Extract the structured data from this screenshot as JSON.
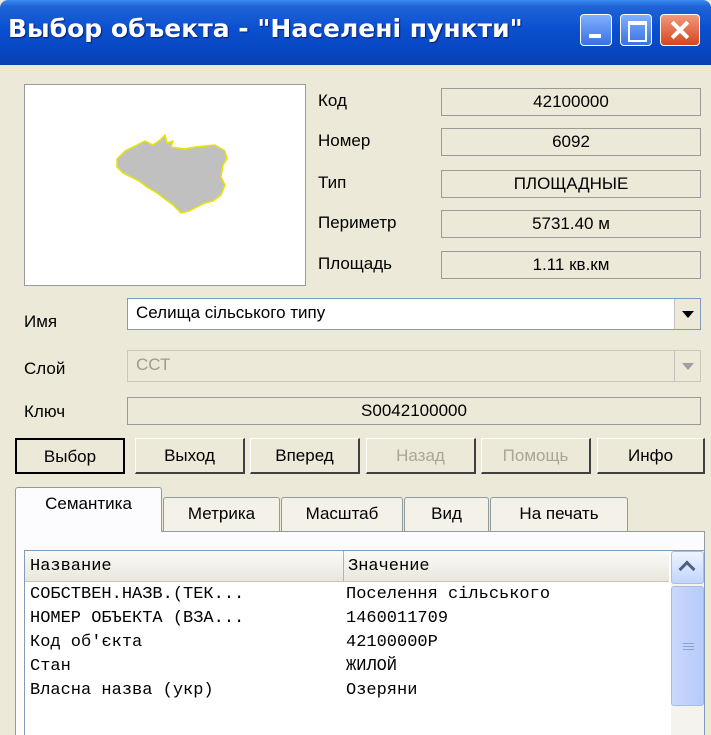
{
  "window": {
    "title": "Выбор объекта - \"Населені пункти\"",
    "buttons": [
      "minimize",
      "maximize",
      "close"
    ]
  },
  "colors": {
    "titlebar": "#0a4fd0",
    "shape_fill": "#c0c0c0",
    "shape_outline": "#e6e600",
    "close": "#d6461e"
  },
  "info": {
    "code_label": "Код",
    "code_value": "42100000",
    "number_label": "Номер",
    "number_value": "6092",
    "type_label": "Тип",
    "type_value": "ПЛОЩАДНЫЕ",
    "perimeter_label": "Периметр",
    "perimeter_value": "5731.40  м",
    "area_label": "Площадь",
    "area_value": "1.11  кв.км"
  },
  "name_row": {
    "label": "Имя",
    "value": "Селища сільського типу"
  },
  "layer_row": {
    "label": "Слой",
    "value": "ССТ"
  },
  "key_row": {
    "label": "Ключ",
    "value": "S0042100000"
  },
  "buttons": {
    "select": "Выбор",
    "exit": "Выход",
    "forward": "Вперед",
    "back": "Назад",
    "help": "Помощь",
    "info": "Инфо"
  },
  "tabs": [
    "Семантика",
    "Метрика",
    "Масштаб",
    "Вид",
    "На печать"
  ],
  "grid": {
    "headers": [
      "Название",
      "Значение"
    ],
    "rows": [
      [
        "СОБСТВЕН.НАЗВ.(ТЕК...",
        "Поселення сільського"
      ],
      [
        "НОМЕР ОБЪЕКТА (ВЗА...",
        "1460011709"
      ],
      [
        "Код об'єкта",
        "42100000Р"
      ],
      [
        "Стан",
        "ЖИЛОЙ"
      ],
      [
        "Власна назва (укр)",
        "Озеряни"
      ]
    ]
  }
}
